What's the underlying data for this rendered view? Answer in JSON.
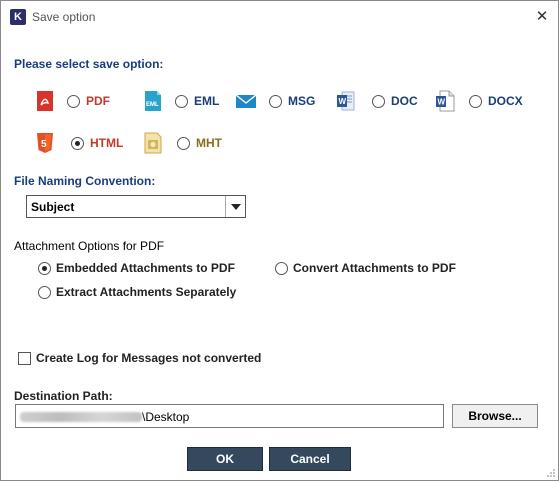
{
  "window": {
    "title": "Save option",
    "logo_letter": "K"
  },
  "save_option": {
    "heading": "Please select save option:",
    "formats": [
      {
        "label": "PDF",
        "icon": "pdf-icon",
        "selected": false,
        "color": "#c0392b"
      },
      {
        "label": "EML",
        "icon": "eml-icon",
        "selected": false,
        "color": "#1a3d7c"
      },
      {
        "label": "MSG",
        "icon": "msg-icon",
        "selected": false,
        "color": "#1a3d7c"
      },
      {
        "label": "DOC",
        "icon": "doc-icon",
        "selected": false,
        "color": "#1a3d7c"
      },
      {
        "label": "DOCX",
        "icon": "docx-icon",
        "selected": false,
        "color": "#1a3d7c"
      },
      {
        "label": "HTML",
        "icon": "html5-icon",
        "selected": true,
        "color": "#c0392b"
      },
      {
        "label": "MHT",
        "icon": "mht-icon",
        "selected": false,
        "color": "#8a6d1d"
      }
    ]
  },
  "naming": {
    "heading": "File Naming Convention:",
    "selected": "Subject"
  },
  "attachments": {
    "heading": "Attachment Options for PDF",
    "options": [
      {
        "label": "Embedded Attachments to PDF",
        "selected": true
      },
      {
        "label": "Convert Attachments to PDF",
        "selected": false
      },
      {
        "label": "Extract Attachments Separately",
        "selected": false
      }
    ]
  },
  "log": {
    "label": "Create Log for Messages not converted",
    "checked": false
  },
  "destination": {
    "heading": "Destination Path:",
    "path_suffix": "\\Desktop",
    "browse_label": "Browse..."
  },
  "buttons": {
    "ok": "OK",
    "cancel": "Cancel"
  }
}
